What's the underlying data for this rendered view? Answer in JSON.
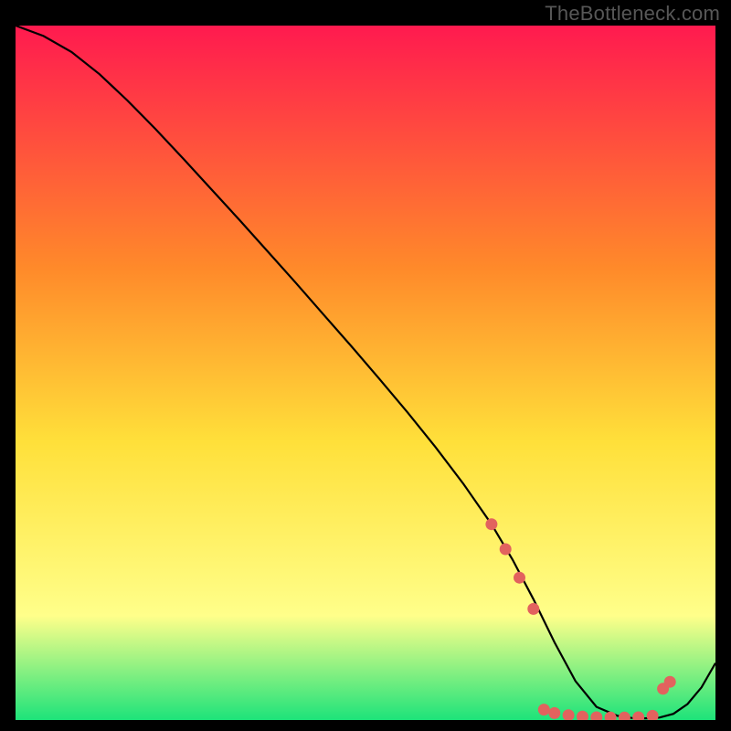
{
  "watermark": "TheBottleneck.com",
  "colors": {
    "gradient_top": "#ff1a4f",
    "gradient_upper_mid": "#ff8a2a",
    "gradient_mid": "#ffe03a",
    "gradient_lower_mid": "#ffff8a",
    "gradient_bottom": "#1de37a",
    "curve": "#000000",
    "marker": "#e2625e",
    "background": "#000000"
  },
  "chart_data": {
    "type": "line",
    "title": "",
    "xlabel": "",
    "ylabel": "",
    "xlim": [
      0,
      100
    ],
    "ylim": [
      0,
      100
    ],
    "series": [
      {
        "name": "curve",
        "x": [
          0,
          4,
          8,
          12,
          16,
          20,
          24,
          28,
          32,
          36,
          40,
          44,
          48,
          52,
          56,
          60,
          64,
          68,
          71,
          74,
          77,
          80,
          83,
          86,
          88,
          90,
          92,
          94,
          96,
          98,
          100
        ],
        "y": [
          100,
          98.5,
          96.2,
          93.0,
          89.2,
          85.1,
          80.8,
          76.4,
          72.0,
          67.5,
          63.0,
          58.4,
          53.8,
          49.1,
          44.3,
          39.3,
          34.0,
          28.2,
          23.1,
          17.4,
          11.2,
          5.6,
          1.9,
          0.6,
          0.3,
          0.25,
          0.35,
          0.9,
          2.3,
          4.7,
          8.2
        ]
      }
    ],
    "markers": [
      {
        "x": 68,
        "y": 28.2
      },
      {
        "x": 70,
        "y": 24.6
      },
      {
        "x": 72,
        "y": 20.5
      },
      {
        "x": 74,
        "y": 16.0
      },
      {
        "x": 75.5,
        "y": 1.5
      },
      {
        "x": 77,
        "y": 1.0
      },
      {
        "x": 79,
        "y": 0.7
      },
      {
        "x": 81,
        "y": 0.5
      },
      {
        "x": 83,
        "y": 0.4
      },
      {
        "x": 85,
        "y": 0.35
      },
      {
        "x": 87,
        "y": 0.35
      },
      {
        "x": 89,
        "y": 0.4
      },
      {
        "x": 91,
        "y": 0.6
      },
      {
        "x": 92.5,
        "y": 4.5
      },
      {
        "x": 93.5,
        "y": 5.5
      }
    ]
  }
}
